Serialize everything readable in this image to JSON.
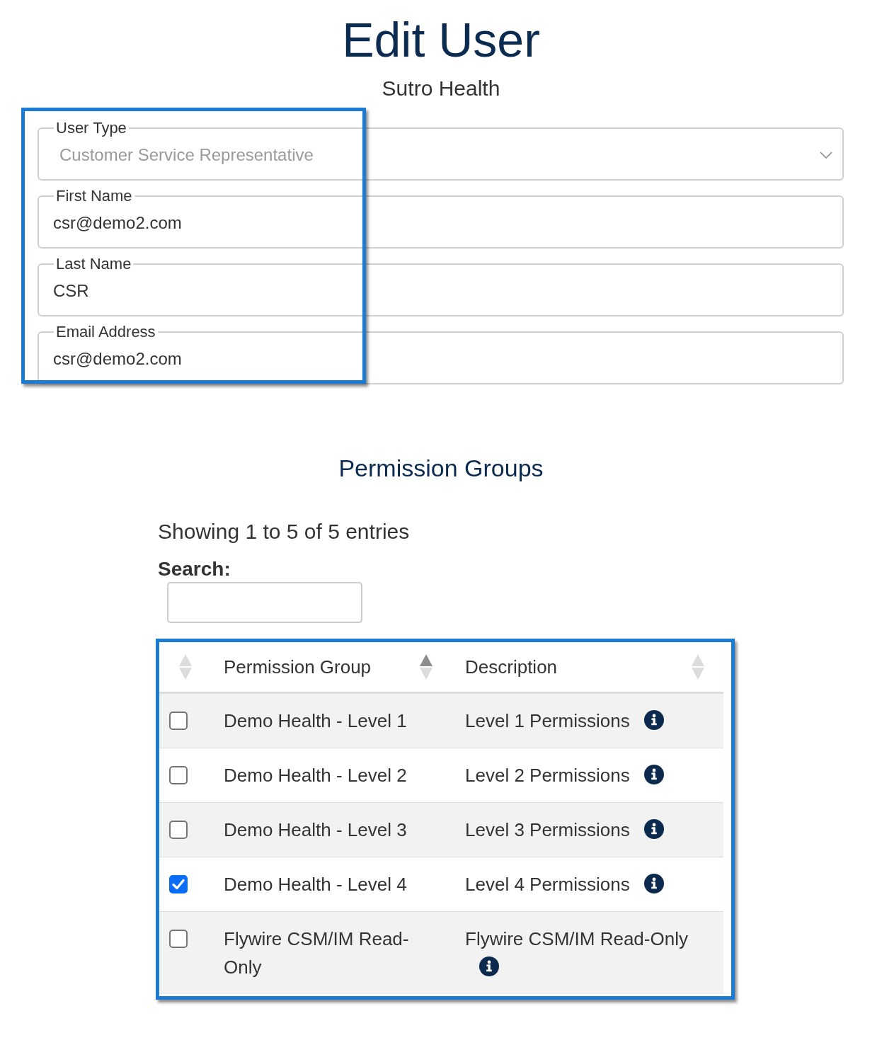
{
  "title": "Edit User",
  "subtitle": "Sutro Health",
  "form": {
    "fields": [
      {
        "kind": "select",
        "label": "User Type",
        "value": "Customer Service Representative",
        "disabled": true
      },
      {
        "kind": "text",
        "label": "First Name",
        "value": "csr@demo2.com",
        "disabled": false
      },
      {
        "kind": "text",
        "label": "Last Name",
        "value": "CSR",
        "disabled": false
      },
      {
        "kind": "text",
        "label": "Email Address",
        "value": "csr@demo2.com",
        "disabled": false
      }
    ]
  },
  "permissions": {
    "title": "Permission Groups",
    "summary": "Showing 1 to 5 of 5 entries",
    "search": {
      "label": "Search:"
    },
    "table": {
      "columns": [
        {
          "sorted": false
        },
        {
          "label": "Permission Group",
          "sorted": true
        },
        {
          "label": "Description",
          "sorted": false
        }
      ],
      "rows": [
        {
          "checked": false,
          "group": "Demo Health - Level 1",
          "description": "Level 1 Permissions"
        },
        {
          "checked": false,
          "group": "Demo Health - Level 2",
          "description": "Level 2 Permissions"
        },
        {
          "checked": false,
          "group": "Demo Health - Level 3",
          "description": "Level 3 Permissions"
        },
        {
          "checked": true,
          "group": "Demo Health - Level 4",
          "description": "Level 4 Permissions"
        },
        {
          "checked": false,
          "group": "Flywire CSM/IM Read-Only",
          "description": "Flywire CSM/IM Read-Only"
        }
      ]
    }
  }
}
